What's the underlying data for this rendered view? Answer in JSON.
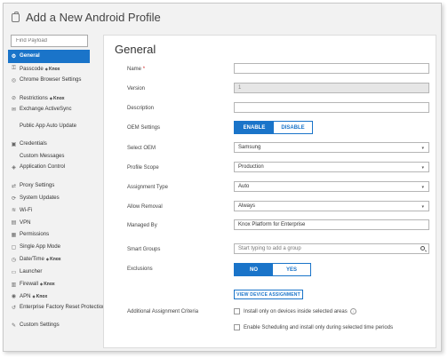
{
  "header": {
    "title": "Add a New Android Profile",
    "icon": "android-profile-icon"
  },
  "sidebar": {
    "find_placeholder": "Find Payload",
    "knox_label": "Knox",
    "items": [
      {
        "label": "General",
        "icon": "general-icon",
        "active": true
      },
      {
        "label": "Passcode",
        "icon": "passcode-icon",
        "knox": true
      },
      {
        "label": "Chrome Browser Settings",
        "icon": "chrome-icon"
      },
      {
        "label": "Restrictions",
        "icon": "restrictions-icon",
        "knox": true
      },
      {
        "label": "Exchange ActiveSync",
        "icon": "exchange-icon"
      },
      {
        "label": "Public App Auto Update",
        "icon": "none"
      },
      {
        "label": "Credentials",
        "icon": "credentials-icon"
      },
      {
        "label": "Custom Messages",
        "icon": "none"
      },
      {
        "label": "Application Control",
        "icon": "app-control-icon"
      },
      {
        "label": "Proxy Settings",
        "icon": "proxy-icon"
      },
      {
        "label": "System Updates",
        "icon": "system-updates-icon"
      },
      {
        "label": "Wi-Fi",
        "icon": "wifi-icon"
      },
      {
        "label": "VPN",
        "icon": "vpn-icon"
      },
      {
        "label": "Permissions",
        "icon": "permissions-icon"
      },
      {
        "label": "Single App Mode",
        "icon": "single-app-icon"
      },
      {
        "label": "Date/Time",
        "icon": "date-time-icon",
        "knox": true
      },
      {
        "label": "Launcher",
        "icon": "launcher-icon"
      },
      {
        "label": "Firewall",
        "icon": "firewall-icon",
        "knox": true
      },
      {
        "label": "APN",
        "icon": "apn-icon",
        "knox": true
      },
      {
        "label": "Enterprise Factory Reset Protection",
        "icon": "factory-reset-icon"
      },
      {
        "label": "Custom Settings",
        "icon": "custom-settings-icon"
      }
    ]
  },
  "main": {
    "title": "General",
    "labels": {
      "name": "Name",
      "required_mark": "*",
      "version": "Version",
      "description": "Description",
      "oem_settings": "OEM Settings",
      "select_oem": "Select OEM",
      "profile_scope": "Profile Scope",
      "assignment_type": "Assignment Type",
      "allow_removal": "Allow Removal",
      "managed_by": "Managed By",
      "smart_groups": "Smart Groups",
      "exclusions": "Exclusions",
      "additional_criteria": "Additional Assignment Criteria"
    },
    "values": {
      "name": "",
      "version": "1",
      "description": "",
      "select_oem": "Samsung",
      "profile_scope": "Production",
      "assignment_type": "Auto",
      "allow_removal": "Always",
      "managed_by": "Knox Platform for Enterprise",
      "smart_groups_placeholder": "Start typing to add a group"
    },
    "oem_toggle": {
      "enable": "ENABLE",
      "disable": "DISABLE",
      "selected": "enable"
    },
    "exclusions_toggle": {
      "no": "NO",
      "yes": "YES",
      "selected": "no"
    },
    "view_assignment_button": "VIEW DEVICE ASSIGNMENT",
    "checkboxes": {
      "inside_areas": {
        "label": "Install only on devices inside selected areas",
        "checked": false
      },
      "scheduling": {
        "label": "Enable Scheduling and install only during selected time periods",
        "checked": false
      }
    },
    "info_glyph": "i",
    "caret_glyph": "▾"
  },
  "colors": {
    "accent": "#1a74c9",
    "panel_bg": "#ffffff",
    "frame_bg": "#f2f2f2",
    "required": "#d02020"
  }
}
